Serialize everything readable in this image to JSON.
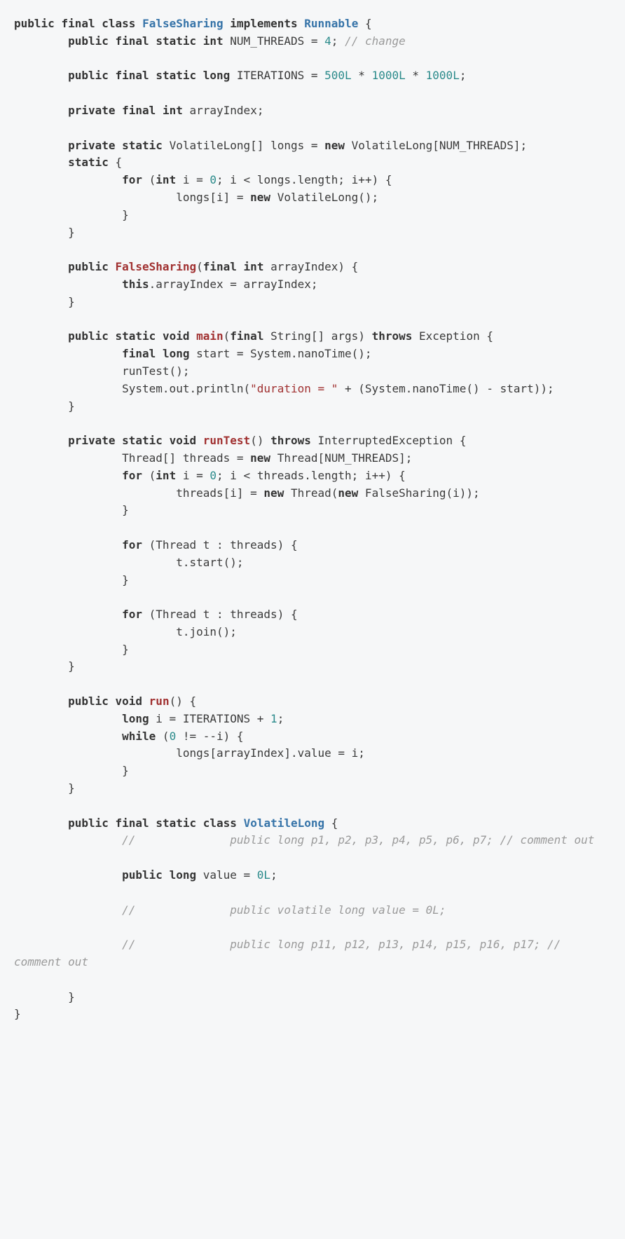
{
  "code": {
    "lines": [
      {
        "seg": [
          {
            "t": "public",
            "c": "kw"
          },
          {
            "t": " "
          },
          {
            "t": "final",
            "c": "kw"
          },
          {
            "t": " "
          },
          {
            "t": "class",
            "c": "kw"
          },
          {
            "t": " "
          },
          {
            "t": "FalseSharing",
            "c": "cname"
          },
          {
            "t": " "
          },
          {
            "t": "implements",
            "c": "kw"
          },
          {
            "t": " "
          },
          {
            "t": "Runnable",
            "c": "cname"
          },
          {
            "t": " {"
          }
        ]
      },
      {
        "seg": [
          {
            "t": "        "
          },
          {
            "t": "public",
            "c": "kw"
          },
          {
            "t": " "
          },
          {
            "t": "final",
            "c": "kw"
          },
          {
            "t": " "
          },
          {
            "t": "static",
            "c": "kw"
          },
          {
            "t": " "
          },
          {
            "t": "int",
            "c": "kw"
          },
          {
            "t": " NUM_THREADS = "
          },
          {
            "t": "4",
            "c": "num"
          },
          {
            "t": "; "
          },
          {
            "t": "// change",
            "c": "cmt"
          }
        ]
      },
      {
        "seg": [
          {
            "t": ""
          }
        ]
      },
      {
        "seg": [
          {
            "t": "        "
          },
          {
            "t": "public",
            "c": "kw"
          },
          {
            "t": " "
          },
          {
            "t": "final",
            "c": "kw"
          },
          {
            "t": " "
          },
          {
            "t": "static",
            "c": "kw"
          },
          {
            "t": " "
          },
          {
            "t": "long",
            "c": "kw"
          },
          {
            "t": " ITERATIONS = "
          },
          {
            "t": "500L",
            "c": "num"
          },
          {
            "t": " * "
          },
          {
            "t": "1000L",
            "c": "num"
          },
          {
            "t": " * "
          },
          {
            "t": "1000L",
            "c": "num"
          },
          {
            "t": ";"
          }
        ]
      },
      {
        "seg": [
          {
            "t": ""
          }
        ]
      },
      {
        "seg": [
          {
            "t": "        "
          },
          {
            "t": "private",
            "c": "kw"
          },
          {
            "t": " "
          },
          {
            "t": "final",
            "c": "kw"
          },
          {
            "t": " "
          },
          {
            "t": "int",
            "c": "kw"
          },
          {
            "t": " arrayIndex;"
          }
        ]
      },
      {
        "seg": [
          {
            "t": ""
          }
        ]
      },
      {
        "seg": [
          {
            "t": "        "
          },
          {
            "t": "private",
            "c": "kw"
          },
          {
            "t": " "
          },
          {
            "t": "static",
            "c": "kw"
          },
          {
            "t": " VolatileLong[] longs = "
          },
          {
            "t": "new",
            "c": "kw"
          },
          {
            "t": " VolatileLong[NUM_THREADS];"
          }
        ]
      },
      {
        "seg": [
          {
            "t": "        "
          },
          {
            "t": "static",
            "c": "kw"
          },
          {
            "t": " {"
          }
        ]
      },
      {
        "seg": [
          {
            "t": "                "
          },
          {
            "t": "for",
            "c": "kw"
          },
          {
            "t": " ("
          },
          {
            "t": "int",
            "c": "kw"
          },
          {
            "t": " i = "
          },
          {
            "t": "0",
            "c": "num"
          },
          {
            "t": "; i < longs.length; i++) {"
          }
        ]
      },
      {
        "seg": [
          {
            "t": "                        longs[i] = "
          },
          {
            "t": "new",
            "c": "kw"
          },
          {
            "t": " VolatileLong();"
          }
        ]
      },
      {
        "seg": [
          {
            "t": "                }"
          }
        ]
      },
      {
        "seg": [
          {
            "t": "        }"
          }
        ]
      },
      {
        "seg": [
          {
            "t": ""
          }
        ]
      },
      {
        "seg": [
          {
            "t": "        "
          },
          {
            "t": "public",
            "c": "kw"
          },
          {
            "t": " "
          },
          {
            "t": "FalseSharing",
            "c": "mname"
          },
          {
            "t": "("
          },
          {
            "t": "final",
            "c": "kw"
          },
          {
            "t": " "
          },
          {
            "t": "int",
            "c": "kw"
          },
          {
            "t": " arrayIndex) {"
          }
        ]
      },
      {
        "seg": [
          {
            "t": "                "
          },
          {
            "t": "this",
            "c": "kw"
          },
          {
            "t": ".arrayIndex = arrayIndex;"
          }
        ]
      },
      {
        "seg": [
          {
            "t": "        }"
          }
        ]
      },
      {
        "seg": [
          {
            "t": ""
          }
        ]
      },
      {
        "seg": [
          {
            "t": "        "
          },
          {
            "t": "public",
            "c": "kw"
          },
          {
            "t": " "
          },
          {
            "t": "static",
            "c": "kw"
          },
          {
            "t": " "
          },
          {
            "t": "void",
            "c": "kw"
          },
          {
            "t": " "
          },
          {
            "t": "main",
            "c": "mname"
          },
          {
            "t": "("
          },
          {
            "t": "final",
            "c": "kw"
          },
          {
            "t": " String[] args) "
          },
          {
            "t": "throws",
            "c": "kw"
          },
          {
            "t": " Exception {"
          }
        ]
      },
      {
        "seg": [
          {
            "t": "                "
          },
          {
            "t": "final",
            "c": "kw"
          },
          {
            "t": " "
          },
          {
            "t": "long",
            "c": "kw"
          },
          {
            "t": " start = System.nanoTime();"
          }
        ]
      },
      {
        "seg": [
          {
            "t": "                runTest();"
          }
        ]
      },
      {
        "seg": [
          {
            "t": "                System.out.println("
          },
          {
            "t": "\"duration = \"",
            "c": "str"
          },
          {
            "t": " + (System.nanoTime() - start));"
          }
        ]
      },
      {
        "seg": [
          {
            "t": "        }"
          }
        ]
      },
      {
        "seg": [
          {
            "t": ""
          }
        ]
      },
      {
        "seg": [
          {
            "t": "        "
          },
          {
            "t": "private",
            "c": "kw"
          },
          {
            "t": " "
          },
          {
            "t": "static",
            "c": "kw"
          },
          {
            "t": " "
          },
          {
            "t": "void",
            "c": "kw"
          },
          {
            "t": " "
          },
          {
            "t": "runTest",
            "c": "mname"
          },
          {
            "t": "() "
          },
          {
            "t": "throws",
            "c": "kw"
          },
          {
            "t": " InterruptedException {"
          }
        ]
      },
      {
        "seg": [
          {
            "t": "                Thread[] threads = "
          },
          {
            "t": "new",
            "c": "kw"
          },
          {
            "t": " Thread[NUM_THREADS];"
          }
        ]
      },
      {
        "seg": [
          {
            "t": "                "
          },
          {
            "t": "for",
            "c": "kw"
          },
          {
            "t": " ("
          },
          {
            "t": "int",
            "c": "kw"
          },
          {
            "t": " i = "
          },
          {
            "t": "0",
            "c": "num"
          },
          {
            "t": "; i < threads.length; i++) {"
          }
        ]
      },
      {
        "seg": [
          {
            "t": "                        threads[i] = "
          },
          {
            "t": "new",
            "c": "kw"
          },
          {
            "t": " Thread("
          },
          {
            "t": "new",
            "c": "kw"
          },
          {
            "t": " FalseSharing(i));"
          }
        ]
      },
      {
        "seg": [
          {
            "t": "                }"
          }
        ]
      },
      {
        "seg": [
          {
            "t": ""
          }
        ]
      },
      {
        "seg": [
          {
            "t": "                "
          },
          {
            "t": "for",
            "c": "kw"
          },
          {
            "t": " (Thread t : threads) {"
          }
        ]
      },
      {
        "seg": [
          {
            "t": "                        t.start();"
          }
        ]
      },
      {
        "seg": [
          {
            "t": "                }"
          }
        ]
      },
      {
        "seg": [
          {
            "t": ""
          }
        ]
      },
      {
        "seg": [
          {
            "t": "                "
          },
          {
            "t": "for",
            "c": "kw"
          },
          {
            "t": " (Thread t : threads) {"
          }
        ]
      },
      {
        "seg": [
          {
            "t": "                        t.join();"
          }
        ]
      },
      {
        "seg": [
          {
            "t": "                }"
          }
        ]
      },
      {
        "seg": [
          {
            "t": "        }"
          }
        ]
      },
      {
        "seg": [
          {
            "t": ""
          }
        ]
      },
      {
        "seg": [
          {
            "t": "        "
          },
          {
            "t": "public",
            "c": "kw"
          },
          {
            "t": " "
          },
          {
            "t": "void",
            "c": "kw"
          },
          {
            "t": " "
          },
          {
            "t": "run",
            "c": "mname"
          },
          {
            "t": "() {"
          }
        ]
      },
      {
        "seg": [
          {
            "t": "                "
          },
          {
            "t": "long",
            "c": "kw"
          },
          {
            "t": " i = ITERATIONS + "
          },
          {
            "t": "1",
            "c": "num"
          },
          {
            "t": ";"
          }
        ]
      },
      {
        "seg": [
          {
            "t": "                "
          },
          {
            "t": "while",
            "c": "kw"
          },
          {
            "t": " ("
          },
          {
            "t": "0",
            "c": "num"
          },
          {
            "t": " != --i) {"
          }
        ]
      },
      {
        "seg": [
          {
            "t": "                        longs[arrayIndex].value = i;"
          }
        ]
      },
      {
        "seg": [
          {
            "t": "                }"
          }
        ]
      },
      {
        "seg": [
          {
            "t": "        }"
          }
        ]
      },
      {
        "seg": [
          {
            "t": ""
          }
        ]
      },
      {
        "seg": [
          {
            "t": "        "
          },
          {
            "t": "public",
            "c": "kw"
          },
          {
            "t": " "
          },
          {
            "t": "final",
            "c": "kw"
          },
          {
            "t": " "
          },
          {
            "t": "static",
            "c": "kw"
          },
          {
            "t": " "
          },
          {
            "t": "class",
            "c": "kw"
          },
          {
            "t": " "
          },
          {
            "t": "VolatileLong",
            "c": "cname"
          },
          {
            "t": " {"
          }
        ]
      },
      {
        "seg": [
          {
            "t": "                "
          },
          {
            "t": "//              public long p1, p2, p3, p4, p5, p6, p7; // comment out",
            "c": "cmt"
          }
        ]
      },
      {
        "seg": [
          {
            "t": ""
          }
        ]
      },
      {
        "seg": [
          {
            "t": "                "
          },
          {
            "t": "public",
            "c": "kw"
          },
          {
            "t": " "
          },
          {
            "t": "long",
            "c": "kw"
          },
          {
            "t": " value = "
          },
          {
            "t": "0L",
            "c": "num"
          },
          {
            "t": ";"
          }
        ]
      },
      {
        "seg": [
          {
            "t": ""
          }
        ]
      },
      {
        "seg": [
          {
            "t": "                "
          },
          {
            "t": "//              public volatile long value = 0L;",
            "c": "cmt"
          }
        ]
      },
      {
        "seg": [
          {
            "t": ""
          }
        ]
      },
      {
        "seg": [
          {
            "t": "                "
          },
          {
            "t": "//              public long p11, p12, p13, p14, p15, p16, p17; // comment out",
            "c": "cmt"
          }
        ]
      },
      {
        "seg": [
          {
            "t": ""
          }
        ]
      },
      {
        "seg": [
          {
            "t": "        }"
          }
        ]
      },
      {
        "seg": [
          {
            "t": "}"
          }
        ]
      }
    ]
  }
}
